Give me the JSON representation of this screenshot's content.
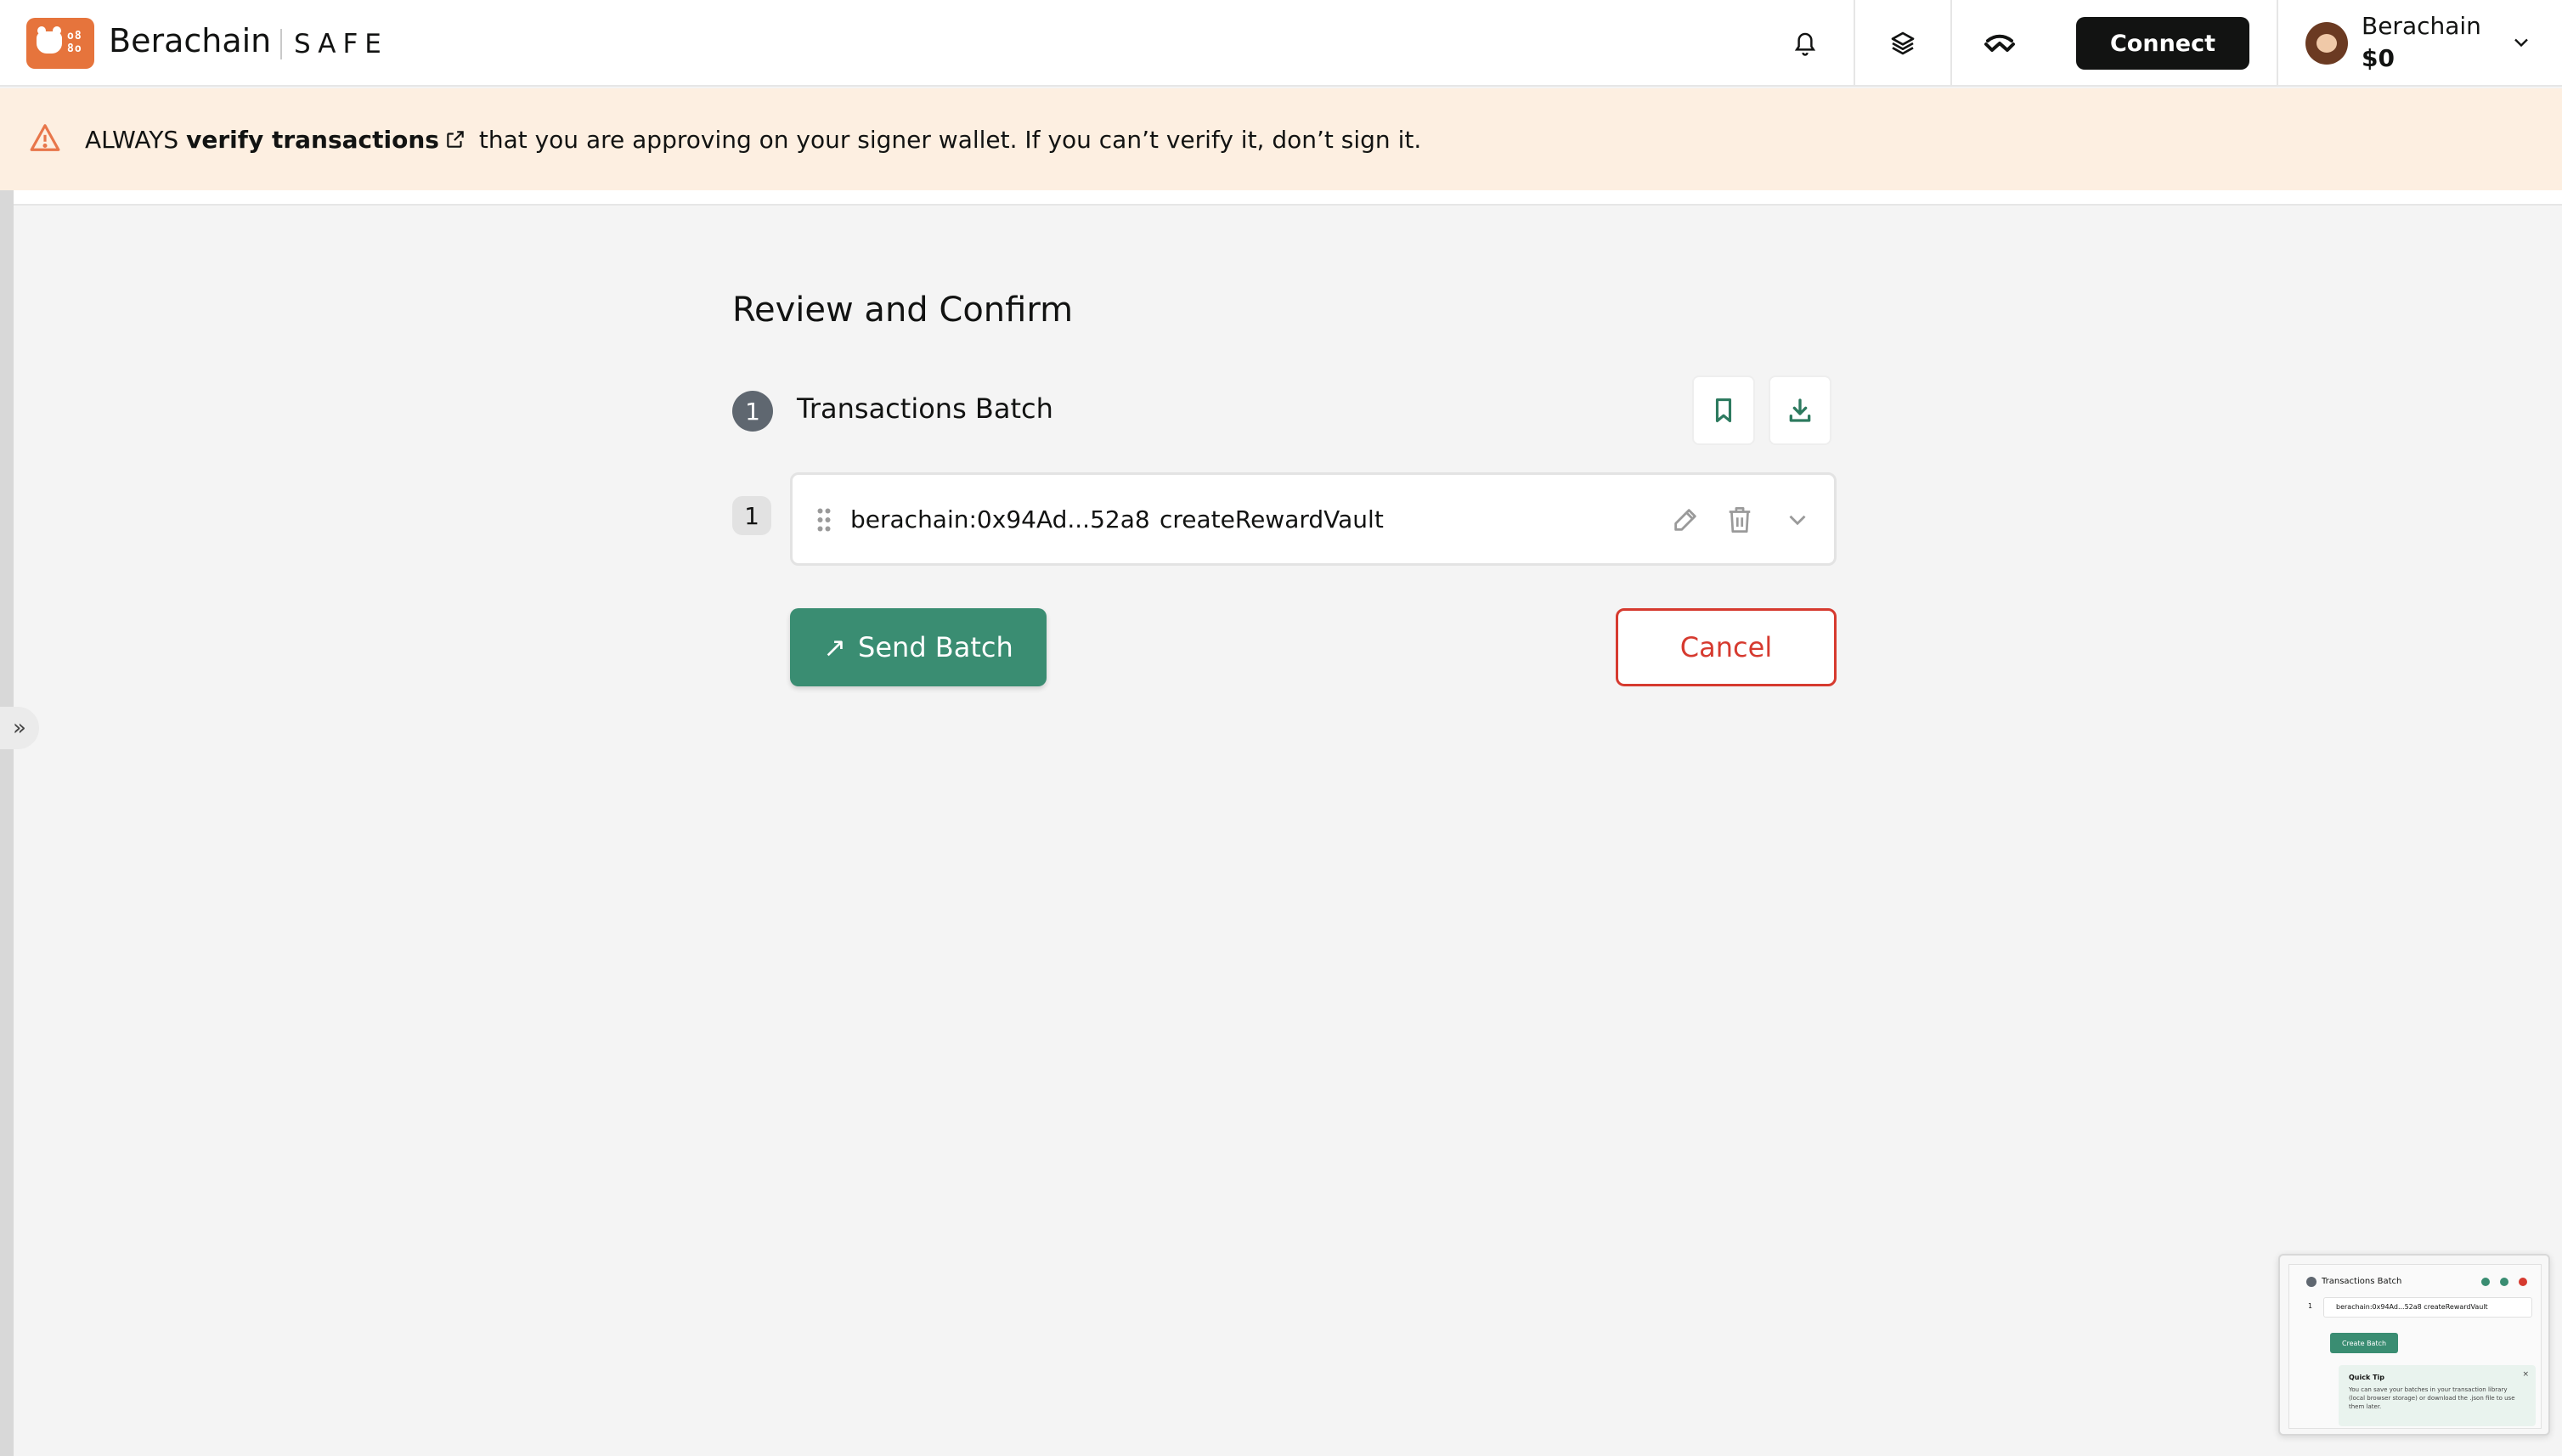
{
  "header": {
    "brand_name": "Berachain",
    "product_name": "SAFE",
    "connect_label": "Connect",
    "account": {
      "network": "Berachain",
      "balance": "$0"
    }
  },
  "banner": {
    "prefix": "ALWAYS",
    "link_text": "verify transactions",
    "suffix": "that you are approving on your signer wallet. If you can’t verify it, don’t sign it."
  },
  "main": {
    "title": "Review and Confirm",
    "batch": {
      "number": "1",
      "title": "Transactions Batch",
      "transactions": [
        {
          "index": "1",
          "address": "berachain:0x94Ad...52a8",
          "method": "createRewardVault"
        }
      ]
    },
    "send_label": "Send Batch",
    "cancel_label": "Cancel"
  },
  "preview": {
    "title": "Transactions Batch",
    "row_index": "1",
    "row_text": "berachain:0x94Ad...52a8     createRewardVault",
    "create_label": "Create Batch",
    "tip_title": "Quick Tip",
    "tip_text": "You can save your batches in your transaction library (local browser storage) or download the .json file to use them later."
  },
  "colors": {
    "accent": "#3a8d72",
    "danger": "#d63a2f",
    "brand": "#e6743c",
    "banner_bg": "#fdefe1"
  }
}
